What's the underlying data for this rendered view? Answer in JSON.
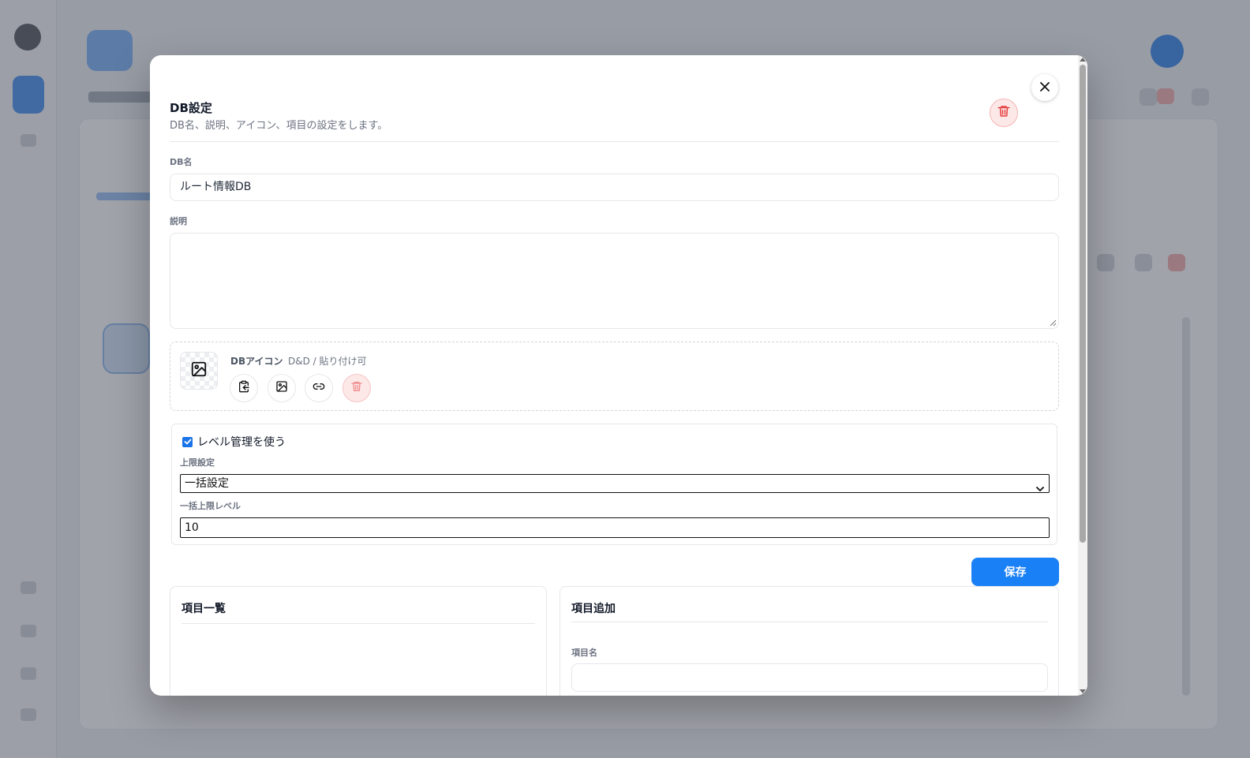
{
  "modal": {
    "title": "DB設定",
    "subtitle": "DB名、説明、アイコン、項目の設定をします。",
    "close_icon": "close-icon",
    "delete_icon": "trash-icon"
  },
  "db_name": {
    "label": "DB名",
    "value": "ルート情報DB"
  },
  "description": {
    "label": "説明",
    "value": ""
  },
  "db_icon": {
    "label": "DBアイコン",
    "hint": "D&D / 貼り付け可",
    "preview_icon": "image-icon",
    "buttons": [
      "paste-icon",
      "image-icon",
      "link-icon",
      "trash-icon"
    ]
  },
  "level": {
    "enabled": true,
    "checkbox_label": "レベル管理を使う",
    "limit_label": "上限設定",
    "limit_value": "一括設定",
    "bulk_label": "一括上限レベル",
    "bulk_value": "10"
  },
  "save_label": "保存",
  "items_panel": {
    "title": "項目一覧"
  },
  "add_panel": {
    "title": "項目追加",
    "name_label": "項目名",
    "name_value": ""
  },
  "colors": {
    "primary": "#1a80f5",
    "danger": "#ef4444",
    "danger_bg": "#fde8e8"
  }
}
